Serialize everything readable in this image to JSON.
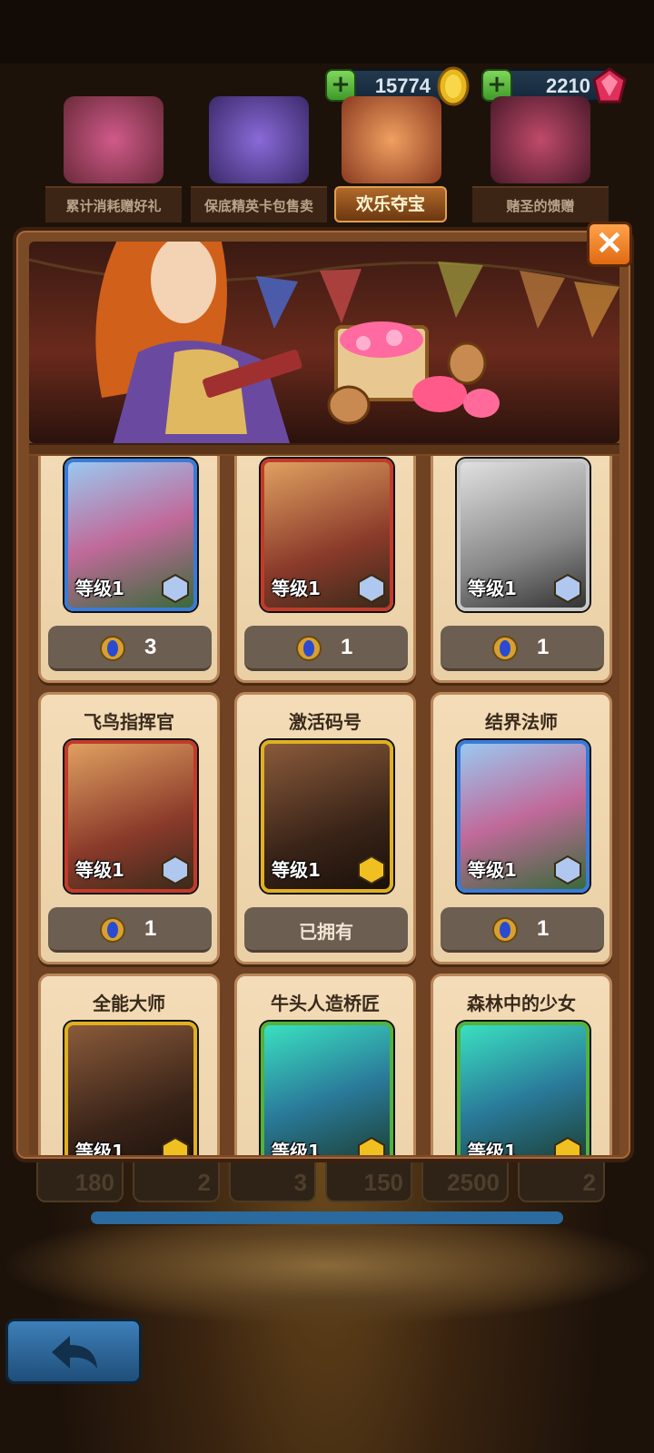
{
  "currency": {
    "gold": "15774",
    "gems": "2210"
  },
  "tabs": [
    {
      "label": "累计消耗赠好礼",
      "active": false
    },
    {
      "label": "保底精英卡包售卖",
      "active": false
    },
    {
      "label": "欢乐夺宝",
      "active": true
    },
    {
      "label": "赌圣的馈赠",
      "active": false
    }
  ],
  "cards": [
    {
      "name": "",
      "level": "等级1",
      "price": "3",
      "owned": false,
      "frame": "blue"
    },
    {
      "name": "",
      "level": "等级1",
      "price": "1",
      "owned": false,
      "frame": "red"
    },
    {
      "name": "",
      "level": "等级1",
      "price": "1",
      "owned": false,
      "frame": "gray"
    },
    {
      "name": "飞鸟指挥官",
      "level": "等级1",
      "price": "1",
      "owned": false,
      "frame": "red"
    },
    {
      "name": "激活码号",
      "level": "等级1",
      "price": "",
      "owned": true,
      "owned_label": "已拥有",
      "frame": "gold"
    },
    {
      "name": "结界法师",
      "level": "等级1",
      "price": "1",
      "owned": false,
      "frame": "blue"
    },
    {
      "name": "全能大师",
      "level": "等级1",
      "price": "",
      "owned": false,
      "frame": "gold"
    },
    {
      "name": "牛头人造桥匠",
      "level": "等级1",
      "price": "",
      "owned": false,
      "frame": "green"
    },
    {
      "name": "森林中的少女",
      "level": "等级1",
      "price": "",
      "owned": false,
      "frame": "green"
    }
  ],
  "reward_strip": [
    "180",
    "2",
    "3",
    "150",
    "2500",
    "2"
  ],
  "colors": {
    "card_bg": "#f3dcb7",
    "price_bg": "#6d5e52",
    "close_btn": "#f08a2a",
    "modal_frame": "#7a4a26"
  }
}
